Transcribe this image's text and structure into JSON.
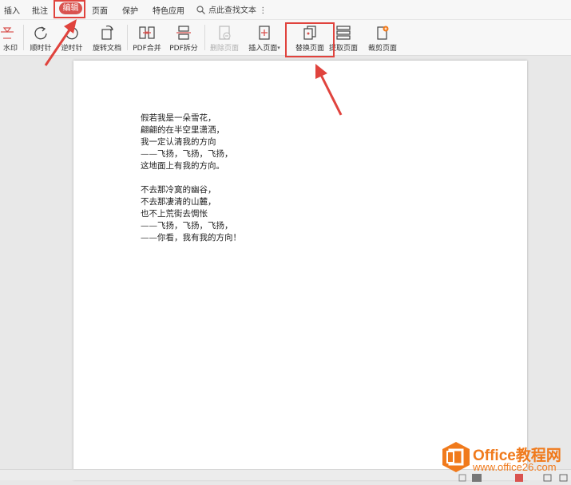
{
  "menubar": {
    "items": [
      {
        "label": "插入"
      },
      {
        "label": "批注"
      },
      {
        "label": "编辑",
        "active": true
      },
      {
        "label": "页面"
      },
      {
        "label": "保护"
      },
      {
        "label": "特色应用"
      }
    ],
    "search_label": "点此查找文本",
    "more_glyph": "⋮"
  },
  "toolbar": {
    "items": [
      {
        "label": "水印",
        "icon": "watermark-icon"
      },
      {
        "label": "顺时针",
        "icon": "rotate-clockwise-icon"
      },
      {
        "label": "逆时针",
        "icon": "rotate-counterclockwise-icon"
      },
      {
        "label": "旋转文档",
        "icon": "rotate-document-icon"
      },
      {
        "label": "PDF合并",
        "icon": "pdf-merge-icon"
      },
      {
        "label": "PDF拆分",
        "icon": "pdf-split-icon"
      },
      {
        "label": "删除页面",
        "icon": "delete-page-icon",
        "disabled": true
      },
      {
        "label": "插入页面",
        "icon": "insert-page-icon"
      },
      {
        "label": "替换页面",
        "icon": "replace-page-icon",
        "highlighted": true
      },
      {
        "label": "提取页面",
        "icon": "extract-page-icon"
      },
      {
        "label": "裁剪页面",
        "icon": "crop-page-icon"
      }
    ]
  },
  "document": {
    "stanza1": [
      "假若我是一朵雪花，",
      "翩翩的在半空里潇洒，",
      "我一定认清我的方向",
      "——飞扬，飞扬，飞扬，",
      "这地面上有我的方向。"
    ],
    "stanza2": [
      "不去那冷寞的幽谷，",
      "不去那凄清的山麓，",
      "也不上荒街去惆怅",
      "——飞扬，飞扬，飞扬，",
      "——你看，我有我的方向！"
    ]
  },
  "watermark": {
    "title": "Office教程网",
    "url": "www.office26.com"
  },
  "colors": {
    "highlight": "#e0433d",
    "brand": "#f07a1c",
    "active_tab": "#d9534f"
  }
}
